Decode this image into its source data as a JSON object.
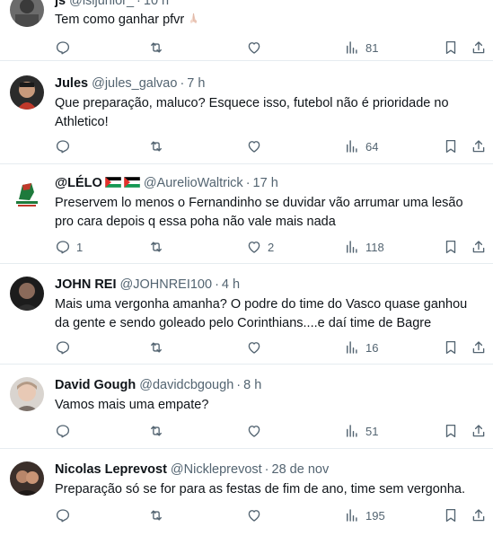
{
  "tweets": [
    {
      "name": "js",
      "handle": "@isijunior_",
      "time": "10 h",
      "text": "Tem como ganhar pfvr",
      "replies": "",
      "retweets": "",
      "likes": "",
      "views": "81",
      "emoji": "praying-hands"
    },
    {
      "name": "Jules",
      "handle": "@jules_galvao",
      "time": "7 h",
      "text": "Que preparação, maluco? Esquece isso, futebol não é prioridade no Athletico!",
      "replies": "",
      "retweets": "",
      "likes": "",
      "views": "64"
    },
    {
      "name": "@LÉLO",
      "handle": "@AurelioWaltrick",
      "time": "17 h",
      "text": "Preservem lo menos o Fernandinho se duvidar vão arrumar uma lesão pro cara  depois q essa poha não vale mais nada",
      "replies": "1",
      "retweets": "",
      "likes": "2",
      "views": "118",
      "flags": [
        "palestine-flag",
        "palestine-flag"
      ]
    },
    {
      "name": "JOHN REI",
      "handle": "@JOHNREI100",
      "time": "4 h",
      "text": "Mais uma vergonha amanha? O podre do time do Vasco quase ganhou da gente e sendo goleado pelo Corinthians....e daí time de Bagre",
      "replies": "",
      "retweets": "",
      "likes": "",
      "views": "16"
    },
    {
      "name": "David Gough",
      "handle": "@davidcbgough",
      "time": "8 h",
      "text": "Vamos mais uma empate?",
      "replies": "",
      "retweets": "",
      "likes": "",
      "views": "51"
    },
    {
      "name": "Nicolas Leprevost",
      "handle": "@Nickleprevost",
      "time": "28 de nov",
      "text": "Preparação só se for para as festas de fim de ano, time sem vergonha.",
      "replies": "",
      "retweets": "",
      "likes": "",
      "views": "195"
    }
  ],
  "separator": "·",
  "colors": {
    "text": "#0f1419",
    "secondary": "#536471",
    "divider": "#e6ecf0"
  },
  "icons": {
    "reply": "reply-icon",
    "retweet": "retweet-icon",
    "like": "heart-icon",
    "views": "views-chart-icon",
    "bookmark": "bookmark-icon",
    "share": "share-icon"
  }
}
